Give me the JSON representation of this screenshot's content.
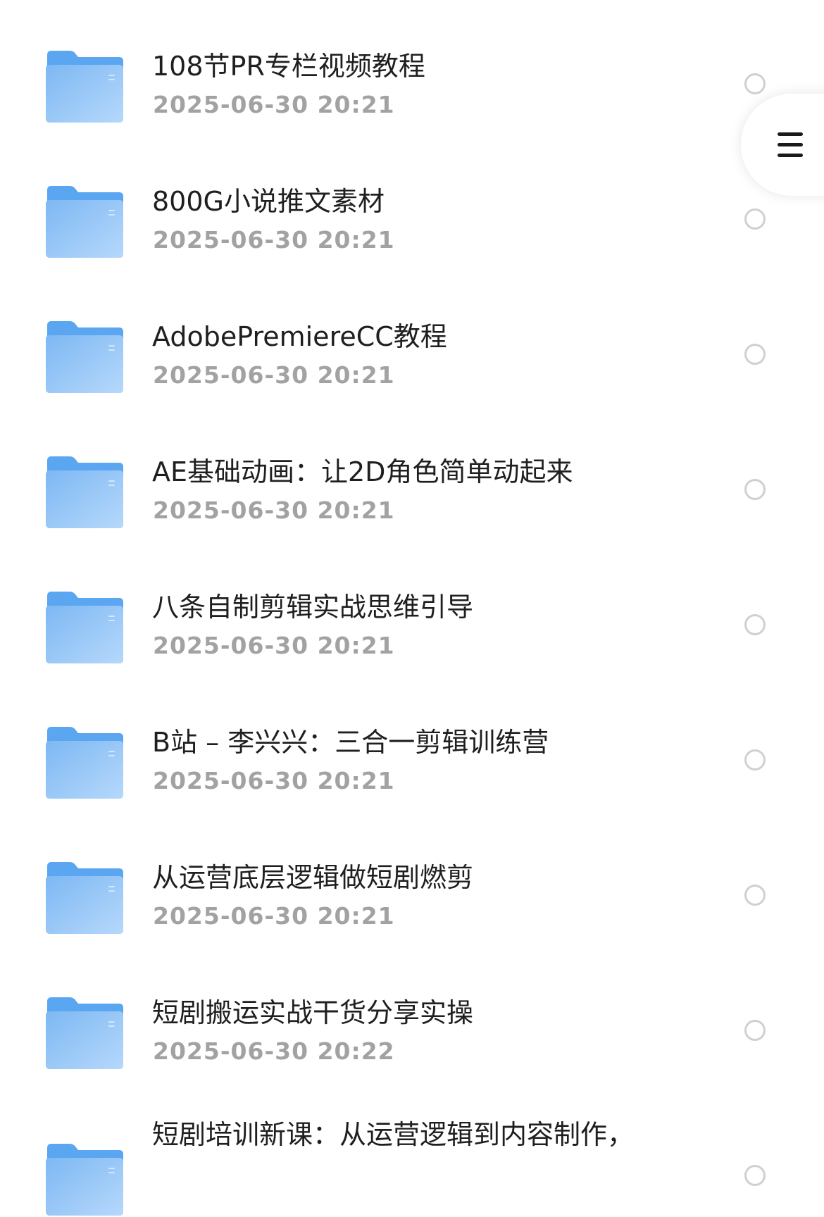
{
  "colors": {
    "folder_front_top": "#7db8f3",
    "folder_front_bottom": "#b6d8fb",
    "folder_back": "#5aa6f0",
    "name_text": "#1f1f1f",
    "date_text": "#a2a2a2",
    "check_border": "#d0d0d0"
  },
  "menu": {
    "icon": "hamburger-menu-icon"
  },
  "files": [
    {
      "name": "108节PR专栏视频教程",
      "date": "2025-06-30 20:21",
      "icon": "folder-icon"
    },
    {
      "name": "800G小说推文素材",
      "date": "2025-06-30 20:21",
      "icon": "folder-icon"
    },
    {
      "name": "AdobePremiereCC教程",
      "date": "2025-06-30 20:21",
      "icon": "folder-icon"
    },
    {
      "name": "AE基础动画：让2D角色简单动起来",
      "date": "2025-06-30 20:21",
      "icon": "folder-icon"
    },
    {
      "name": "八条自制剪辑实战思维引导",
      "date": "2025-06-30 20:21",
      "icon": "folder-icon"
    },
    {
      "name": "B站 – 李兴兴：三合一剪辑训练营",
      "date": "2025-06-30 20:21",
      "icon": "folder-icon"
    },
    {
      "name": "从运营底层逻辑做短剧燃剪",
      "date": "2025-06-30 20:21",
      "icon": "folder-icon"
    },
    {
      "name": "短剧搬运实战干货分享实操",
      "date": "2025-06-30 20:22",
      "icon": "folder-icon"
    },
    {
      "name": "短剧培训新课：从运营逻辑到内容制作，",
      "date": "",
      "icon": "folder-icon"
    }
  ]
}
